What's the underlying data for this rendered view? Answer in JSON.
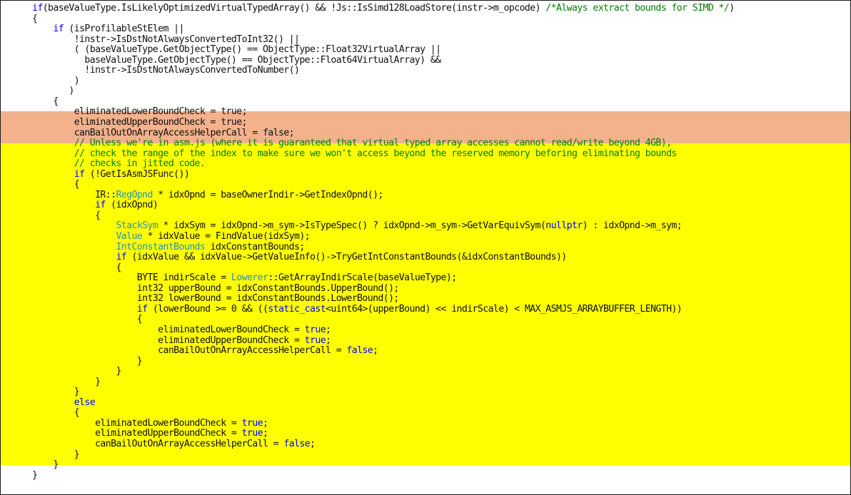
{
  "lines": [
    {
      "i": "",
      "t": [
        [
          "kw",
          "if"
        ],
        [
          "",
          "(baseValueType.IsLikelyOptimizedVirtualTypedArray() && !Js::IsSimd128LoadStore(instr->m_opcode) "
        ],
        [
          "cm",
          "/*Always extract bounds for SIMD */"
        ],
        [
          "",
          ")"
        ]
      ]
    },
    {
      "i": "",
      "t": [
        [
          "",
          "{"
        ]
      ]
    },
    {
      "i": "    ",
      "t": [
        [
          "kw",
          "if"
        ],
        [
          "",
          " (isProfilableStElem ||"
        ]
      ]
    },
    {
      "i": "        ",
      "t": [
        [
          "",
          "!instr->IsDstNotAlwaysConvertedToInt32() ||"
        ]
      ]
    },
    {
      "i": "        ",
      "t": [
        [
          "",
          "( (baseValueType.GetObjectType() == ObjectType::Float32VirtualArray ||"
        ]
      ]
    },
    {
      "i": "          ",
      "t": [
        [
          "",
          "baseValueType.GetObjectType() == ObjectType::Float64VirtualArray) &&"
        ]
      ]
    },
    {
      "i": "          ",
      "t": [
        [
          "",
          "!instr->IsDstNotAlwaysConvertedToNumber()"
        ]
      ]
    },
    {
      "i": "        ",
      "t": [
        [
          "",
          ")"
        ]
      ]
    },
    {
      "i": "       ",
      "t": [
        [
          "",
          ")"
        ]
      ]
    },
    {
      "i": "    ",
      "t": [
        [
          "",
          "{"
        ]
      ]
    },
    {
      "i": "        ",
      "t": [
        [
          "",
          "eliminatedLowerBoundCheck = true;"
        ]
      ]
    },
    {
      "i": "        ",
      "t": [
        [
          "",
          "eliminatedUpperBoundCheck = true;"
        ]
      ]
    },
    {
      "i": "        ",
      "t": [
        [
          "",
          "canBailOutOnArrayAccessHelperCall = false;"
        ]
      ]
    },
    {
      "i": "        ",
      "t": [
        [
          "cm",
          "// Unless we're in asm.js (where it is guaranteed that virtual typed array accesses cannot read/write beyond 4GB),"
        ]
      ]
    },
    {
      "i": "        ",
      "t": [
        [
          "cm",
          "// check the range of the index to make sure we won't access beyond the reserved memory beforing eliminating bounds"
        ]
      ]
    },
    {
      "i": "        ",
      "t": [
        [
          "cm",
          "// checks in jitted code."
        ]
      ]
    },
    {
      "i": "        ",
      "t": [
        [
          "kw",
          "if"
        ],
        [
          "",
          " (!GetIsAsmJSFunc())"
        ]
      ]
    },
    {
      "i": "        ",
      "t": [
        [
          "",
          "{"
        ]
      ]
    },
    {
      "i": "            ",
      "t": [
        [
          "",
          "IR::"
        ],
        [
          "ty",
          "RegOpnd"
        ],
        [
          "",
          " * idxOpnd = baseOwnerIndir->GetIndexOpnd();"
        ]
      ]
    },
    {
      "i": "            ",
      "t": [
        [
          "kw",
          "if"
        ],
        [
          "",
          " (idxOpnd)"
        ]
      ]
    },
    {
      "i": "            ",
      "t": [
        [
          "",
          "{"
        ]
      ]
    },
    {
      "i": "                ",
      "t": [
        [
          "ty",
          "StackSym"
        ],
        [
          "",
          " * idxSym = idxOpnd->m_sym->IsTypeSpec() ? idxOpnd->m_sym->GetVarEquivSym("
        ],
        [
          "kw",
          "nullptr"
        ],
        [
          "",
          ") : idxOpnd->m_sym;"
        ]
      ]
    },
    {
      "i": "                ",
      "t": [
        [
          "ty",
          "Value"
        ],
        [
          "",
          " * idxValue = FindValue(idxSym);"
        ]
      ]
    },
    {
      "i": "                ",
      "t": [
        [
          "ty",
          "IntConstantBounds"
        ],
        [
          "",
          " idxConstantBounds;"
        ]
      ]
    },
    {
      "i": "                ",
      "t": [
        [
          "kw",
          "if"
        ],
        [
          "",
          " (idxValue && idxValue->GetValueInfo()->TryGetIntConstantBounds(&idxConstantBounds))"
        ]
      ]
    },
    {
      "i": "                ",
      "t": [
        [
          "",
          "{"
        ]
      ]
    },
    {
      "i": "                    ",
      "t": [
        [
          "",
          "BYTE indirScale = "
        ],
        [
          "ty",
          "Lowerer"
        ],
        [
          "",
          "::GetArrayIndirScale(baseValueType);"
        ]
      ]
    },
    {
      "i": "                    ",
      "t": [
        [
          "",
          "int32 upperBound = idxConstantBounds.UpperBound();"
        ]
      ]
    },
    {
      "i": "                    ",
      "t": [
        [
          "",
          "int32 lowerBound = idxConstantBounds.LowerBound();"
        ]
      ]
    },
    {
      "i": "                    ",
      "t": [
        [
          "kw",
          "if"
        ],
        [
          "",
          " (lowerBound >= 0 && (("
        ],
        [
          "kw",
          "static_cast"
        ],
        [
          "",
          "<uint64>(upperBound) << indirScale) < MAX_ASMJS_ARRAYBUFFER_LENGTH))"
        ]
      ]
    },
    {
      "i": "                    ",
      "t": [
        [
          "",
          "{"
        ]
      ]
    },
    {
      "i": "                        ",
      "t": [
        [
          "",
          "eliminatedLowerBoundCheck = "
        ],
        [
          "kw",
          "true"
        ],
        [
          "",
          ";"
        ]
      ]
    },
    {
      "i": "                        ",
      "t": [
        [
          "",
          "eliminatedUpperBoundCheck = "
        ],
        [
          "kw",
          "true"
        ],
        [
          "",
          ";"
        ]
      ]
    },
    {
      "i": "                        ",
      "t": [
        [
          "",
          "canBailOutOnArrayAccessHelperCall = "
        ],
        [
          "kw",
          "false"
        ],
        [
          "",
          ";"
        ]
      ]
    },
    {
      "i": "                    ",
      "t": [
        [
          "",
          "}"
        ]
      ]
    },
    {
      "i": "                ",
      "t": [
        [
          "",
          "}"
        ]
      ]
    },
    {
      "i": "            ",
      "t": [
        [
          "",
          "}"
        ]
      ]
    },
    {
      "i": "        ",
      "t": [
        [
          "",
          "}"
        ]
      ]
    },
    {
      "i": "        ",
      "t": [
        [
          "kw",
          "else"
        ]
      ]
    },
    {
      "i": "        ",
      "t": [
        [
          "",
          "{"
        ]
      ]
    },
    {
      "i": "            ",
      "t": [
        [
          "",
          "eliminatedLowerBoundCheck = "
        ],
        [
          "kw",
          "true"
        ],
        [
          "",
          ";"
        ]
      ]
    },
    {
      "i": "            ",
      "t": [
        [
          "",
          "eliminatedUpperBoundCheck = "
        ],
        [
          "kw",
          "true"
        ],
        [
          "",
          ";"
        ]
      ]
    },
    {
      "i": "            ",
      "t": [
        [
          "",
          "canBailOutOnArrayAccessHelperCall = "
        ],
        [
          "kw",
          "false"
        ],
        [
          "",
          ";"
        ]
      ]
    },
    {
      "i": "        ",
      "t": [
        [
          "",
          "}"
        ]
      ]
    },
    {
      "i": "    ",
      "t": [
        [
          "",
          "}"
        ]
      ]
    },
    {
      "i": "",
      "t": [
        [
          "",
          "}"
        ]
      ]
    }
  ],
  "colors": {
    "background": "#ffffff",
    "text": "#111111",
    "keyword": "#0000ff",
    "comment": "#008000",
    "type": "#2b91af",
    "highlight_orange": "#f3b18c",
    "highlight_yellow": "#ffff00"
  }
}
